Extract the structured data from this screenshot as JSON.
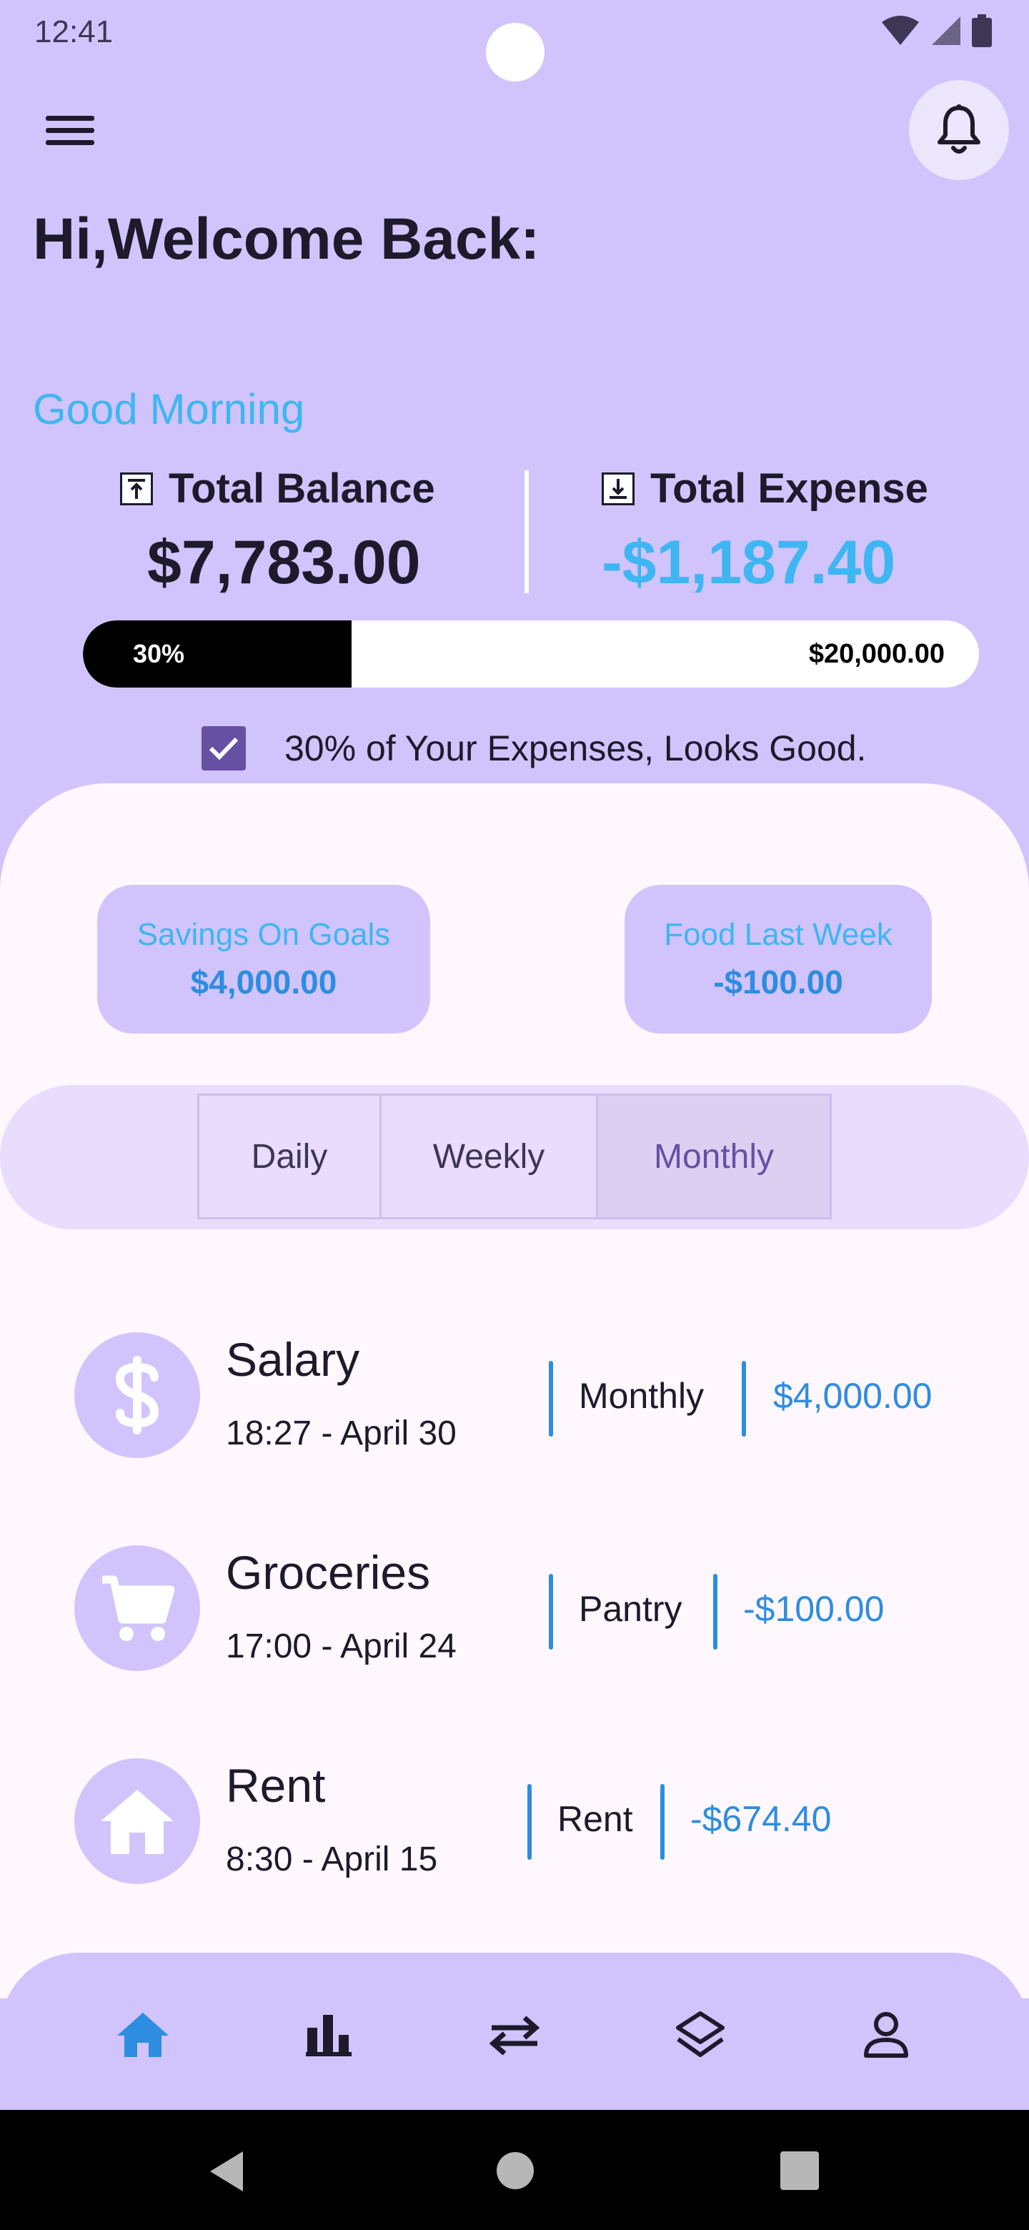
{
  "status_bar": {
    "time": "12:41"
  },
  "header": {
    "greeting": "Hi,Welcome Back:",
    "subgreeting": "Good Morning"
  },
  "balance": {
    "total_balance_label": "Total Balance",
    "total_balance_value": "$7,783.00",
    "total_expense_label": "Total Expense",
    "total_expense_value": "-$1,187.40",
    "progress_percent_label": "30%",
    "progress_fraction": 0.3,
    "progress_goal": "$20,000.00",
    "status_message": "30% of Your Expenses, Looks Good."
  },
  "summary_cards": [
    {
      "label": "Savings On Goals",
      "value": "$4,000.00"
    },
    {
      "label": "Food Last Week",
      "value": "-$100.00"
    }
  ],
  "period_tabs": {
    "daily": "Daily",
    "weekly": "Weekly",
    "monthly": "Monthly",
    "selected": "Monthly"
  },
  "transactions": [
    {
      "title": "Salary",
      "date": "18:27 - April 30",
      "category": "Monthly",
      "amount": "$4,000.00",
      "icon": "dollar-icon"
    },
    {
      "title": "Groceries",
      "date": "17:00 - April 24",
      "category": "Pantry",
      "amount": "-$100.00",
      "icon": "cart-icon"
    },
    {
      "title": "Rent",
      "date": "8:30 - April 15",
      "category": "Rent",
      "amount": "-$674.40",
      "icon": "house-icon"
    }
  ],
  "bottom_nav": {
    "items": [
      "home-icon",
      "analysis-icon",
      "transactions-icon",
      "categories-icon",
      "profile-icon"
    ],
    "active": "home-icon"
  },
  "colors": {
    "header_bg": "#d1c4fd",
    "sheet_bg": "#fff7fe",
    "accent_blue": "#2d8de0",
    "light_blue": "#3eb6f2",
    "dark_text": "#1e1a2b",
    "purple": "#6650a4"
  }
}
